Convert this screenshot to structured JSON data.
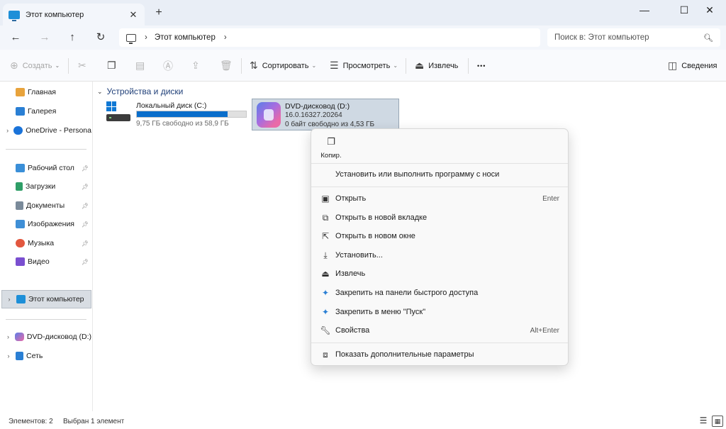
{
  "window": {
    "tab_title": "Этот компьютер",
    "tab_close": "✕",
    "new_tab": "+",
    "minimize": "—",
    "maximize": "☐",
    "close": "✕"
  },
  "nav": {
    "back": "←",
    "forward": "→",
    "up": "↑",
    "refresh": "↻",
    "breadcrumb_sep": "›",
    "location": "Этот компьютер",
    "trailing_chevron": "›",
    "search_placeholder": "Поиск в: Этот компьютер"
  },
  "toolbar": {
    "create_label": "Создать",
    "sort_label": "Сортировать",
    "view_label": "Просмотреть",
    "eject_label": "Извлечь",
    "more_label": "•••",
    "details_label": "Сведения"
  },
  "sidebar": {
    "items": [
      {
        "label": "Главная",
        "icon": "home-icon",
        "color": "#e8a33c"
      },
      {
        "label": "Галерея",
        "icon": "gallery-icon",
        "color": "#2a7fd4"
      },
      {
        "label": "OneDrive - Persona",
        "icon": "cloud-icon",
        "color": "#1a73d9"
      },
      {
        "label": "Рабочий стол",
        "icon": "desktop-icon",
        "color": "#3a8fd8"
      },
      {
        "label": "Загрузки",
        "icon": "download-icon",
        "color": "#2f9e67"
      },
      {
        "label": "Документы",
        "icon": "documents-icon",
        "color": "#7a8a9a"
      },
      {
        "label": "Изображения",
        "icon": "pictures-icon",
        "color": "#3f8fd6"
      },
      {
        "label": "Музыка",
        "icon": "music-icon",
        "color": "#e2573f"
      },
      {
        "label": "Видео",
        "icon": "video-icon",
        "color": "#7a4fd0"
      },
      {
        "label": "Этот компьютер",
        "icon": "computer-icon",
        "color": "#1d8fd8"
      },
      {
        "label": "DVD-дисковод (D:)",
        "icon": "dvd-icon",
        "color": "#9a6ae0"
      },
      {
        "label": "Сеть",
        "icon": "network-icon",
        "color": "#2a7fd4"
      }
    ]
  },
  "content": {
    "group_title": "Устройства и диски",
    "drive_c": {
      "name": "Локальный диск (C:)",
      "free_text": "9,75 ГБ свободно из 58,9 ГБ",
      "used_fraction": 0.834
    },
    "drive_d": {
      "name": "DVD-дисковод (D:)",
      "version": "16.0.16327.20264",
      "free_text": "0 байт свободно из 4,53 ГБ"
    }
  },
  "context_menu": {
    "copy_label": "Копир.",
    "install_run_label": "Установить или выполнить программу с носи",
    "items": [
      {
        "label": "Открыть",
        "shortcut": "Enter",
        "icon": "open-icon"
      },
      {
        "label": "Открыть в новой вкладке",
        "shortcut": "",
        "icon": "new-tab-icon"
      },
      {
        "label": "Открыть в новом окне",
        "shortcut": "",
        "icon": "new-window-icon"
      },
      {
        "label": "Установить...",
        "shortcut": "",
        "icon": "install-icon"
      },
      {
        "label": "Извлечь",
        "shortcut": "",
        "icon": "eject-icon"
      },
      {
        "label": "Закрепить на панели быстрого доступа",
        "shortcut": "",
        "icon": "pin-icon"
      },
      {
        "label": "Закрепить в меню \"Пуск\"",
        "shortcut": "",
        "icon": "pin-start-icon"
      },
      {
        "label": "Свойства",
        "shortcut": "Alt+Enter",
        "icon": "properties-icon"
      }
    ],
    "more_options_label": "Показать дополнительные параметры"
  },
  "status": {
    "items_count": "Элементов: 2",
    "selected": "Выбран 1 элемент"
  }
}
